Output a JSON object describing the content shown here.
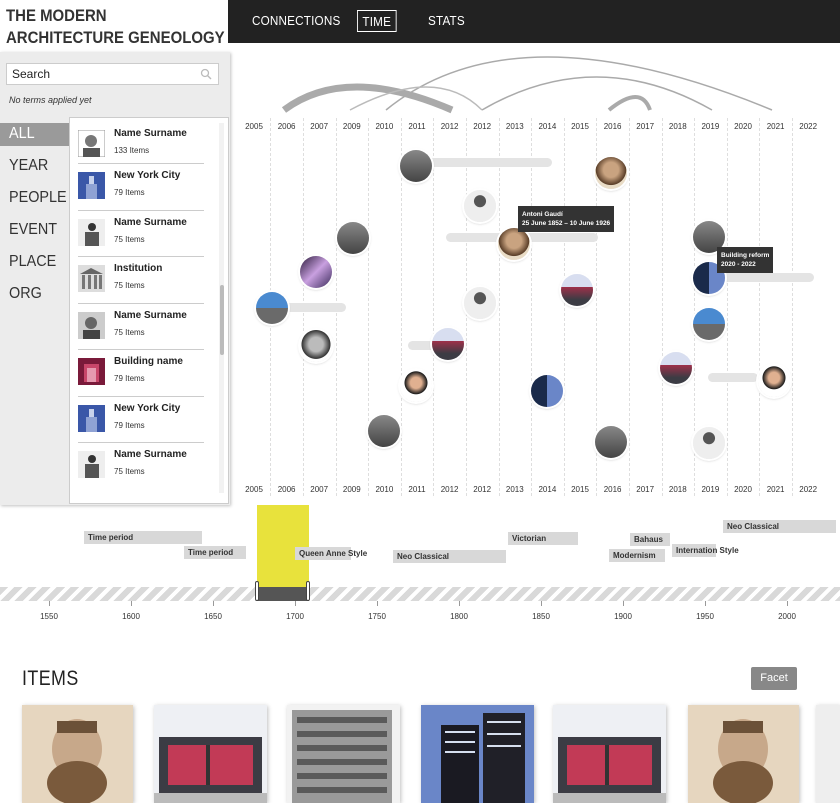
{
  "app": {
    "title_line1": "THE MODERN",
    "title_line2": "ARCHITECTURE GENEOLOGY"
  },
  "nav": {
    "connections": "CONNECTIONS",
    "time": "TIME",
    "stats": "STATS",
    "active": "TIME"
  },
  "search": {
    "placeholder": "Search",
    "value": "Search",
    "no_terms": "No terms applied yet"
  },
  "categories": [
    "ALL",
    "YEAR",
    "PEOPLE",
    "EVENT",
    "PLACE",
    "ORG"
  ],
  "active_category": "ALL",
  "list": [
    {
      "name": "Name Surname",
      "count": "133 Items",
      "thumb": "portrait-bw"
    },
    {
      "name": "New York City",
      "count": "79 Items",
      "thumb": "city-tower"
    },
    {
      "name": "Name Surname",
      "count": "75 Items",
      "thumb": "speaker"
    },
    {
      "name": "Institution",
      "count": "75 Items",
      "thumb": "columns-building"
    },
    {
      "name": "Name Surname",
      "count": "75 Items",
      "thumb": "portrait-bw"
    },
    {
      "name": "Building name",
      "count": "79 Items",
      "thumb": "red-building"
    },
    {
      "name": "New York City",
      "count": "79 Items",
      "thumb": "city-tower"
    },
    {
      "name": "Name Surname",
      "count": "75 Items",
      "thumb": "speaker"
    }
  ],
  "timeline": {
    "years": [
      "2005",
      "2006",
      "2007",
      "2009",
      "2010",
      "2011",
      "2012",
      "2012",
      "2013",
      "2014",
      "2015",
      "2016",
      "2017",
      "2018",
      "2019",
      "2020",
      "2021",
      "2022"
    ],
    "tooltip1_line1": "Antoni Gaudí",
    "tooltip1_line2": "25 June 1852 – 10 June 1926",
    "tooltip2_line1": "Building reform",
    "tooltip2_line2": "2020 - 2022"
  },
  "periods": [
    {
      "label": "Time period",
      "style": "bar"
    },
    {
      "label": "Time period",
      "style": "bar"
    },
    {
      "label": "Queen Anne Style",
      "style": "bar"
    },
    {
      "label": "Neo Classical",
      "style": "bar"
    },
    {
      "label": "Victorian",
      "style": "bar"
    },
    {
      "label": "Bahaus",
      "style": "bar"
    },
    {
      "label": "Modernism",
      "style": "bar"
    },
    {
      "label": "Internation Style",
      "style": "bar"
    },
    {
      "label": "Neo Classical",
      "style": "bar"
    }
  ],
  "axis": [
    "1550",
    "1600",
    "1650",
    "1700",
    "1750",
    "1800",
    "1850",
    "1900",
    "1950",
    "2000"
  ],
  "items": {
    "title": "ITEMS",
    "facet_label": "Facet"
  },
  "colors": {
    "topbar": "#222222",
    "brush": "#e8e23c",
    "sidebar": "#ececec",
    "active_category": "#9a9a9a"
  }
}
